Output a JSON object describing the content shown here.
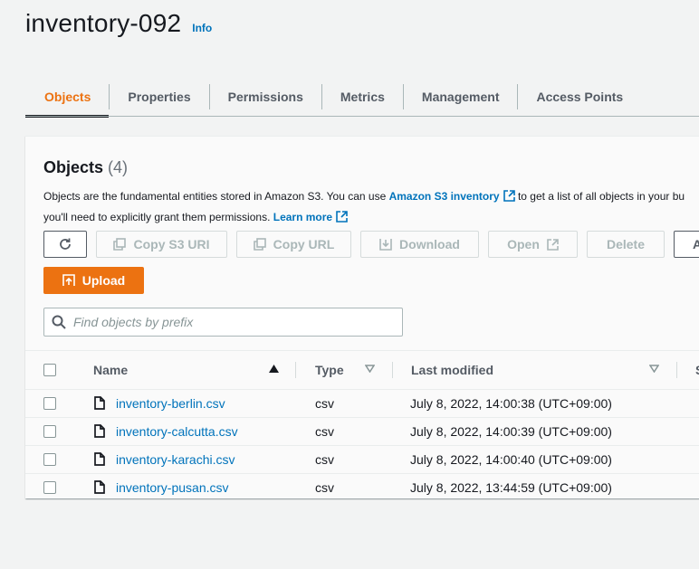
{
  "header": {
    "title": "inventory-092",
    "info_link": "Info"
  },
  "tabs": [
    {
      "label": "Objects",
      "active": true
    },
    {
      "label": "Properties"
    },
    {
      "label": "Permissions"
    },
    {
      "label": "Metrics"
    },
    {
      "label": "Management"
    },
    {
      "label": "Access Points"
    }
  ],
  "panel": {
    "heading": "Objects",
    "count": "(4)",
    "description": {
      "part1": "Objects are the fundamental entities stored in Amazon S3. You can use ",
      "inventory_link": "Amazon S3 inventory",
      "part2": " to get a list of all objects in your bu",
      "line2": "you'll need to explicitly grant them permissions. ",
      "learn_more": "Learn more"
    },
    "toolbar": {
      "copy_s3_uri": "Copy S3 URI",
      "copy_url": "Copy URL",
      "download": "Download",
      "open": "Open",
      "delete": "Delete",
      "actions": "A",
      "upload": "Upload"
    },
    "search": {
      "placeholder": "Find objects by prefix",
      "value": ""
    }
  },
  "table": {
    "columns": {
      "name": "Name",
      "type": "Type",
      "last_modified": "Last modified",
      "next": "S"
    },
    "rows": [
      {
        "name": "inventory-berlin.csv",
        "type": "csv",
        "last_modified": "July 8, 2022, 14:00:38 (UTC+09:00)"
      },
      {
        "name": "inventory-calcutta.csv",
        "type": "csv",
        "last_modified": "July 8, 2022, 14:00:39 (UTC+09:00)"
      },
      {
        "name": "inventory-karachi.csv",
        "type": "csv",
        "last_modified": "July 8, 2022, 14:00:40 (UTC+09:00)"
      },
      {
        "name": "inventory-pusan.csv",
        "type": "csv",
        "last_modified": "July 8, 2022, 13:44:59 (UTC+09:00)"
      }
    ]
  },
  "colors": {
    "accent": "#ec7211",
    "link": "#0073bb",
    "text": "#16191f",
    "muted": "#545b64",
    "disabled": "#aab7b8"
  }
}
